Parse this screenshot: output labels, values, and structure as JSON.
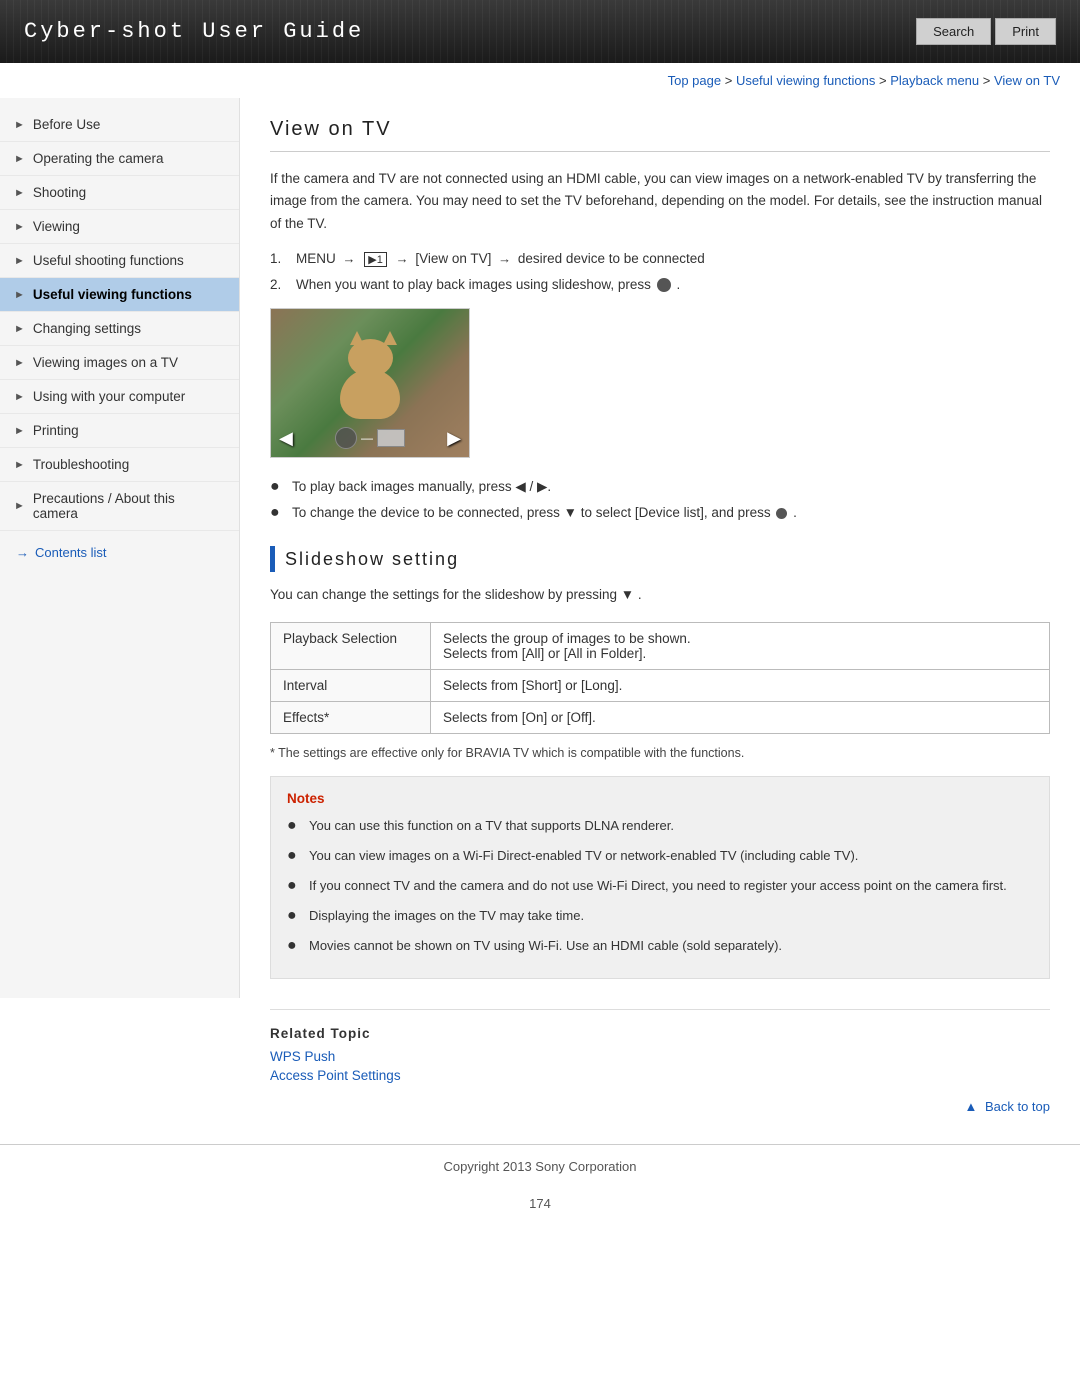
{
  "header": {
    "title": "Cyber-shot User Guide",
    "search_label": "Search",
    "print_label": "Print"
  },
  "breadcrumb": {
    "items": [
      {
        "label": "Top page",
        "href": "#"
      },
      {
        "label": "Useful viewing functions",
        "href": "#"
      },
      {
        "label": "Playback menu",
        "href": "#"
      },
      {
        "label": "View on TV",
        "href": "#"
      }
    ]
  },
  "sidebar": {
    "items": [
      {
        "label": "Before Use",
        "active": false
      },
      {
        "label": "Operating the camera",
        "active": false
      },
      {
        "label": "Shooting",
        "active": false
      },
      {
        "label": "Viewing",
        "active": false
      },
      {
        "label": "Useful shooting functions",
        "active": false
      },
      {
        "label": "Useful viewing functions",
        "active": true
      },
      {
        "label": "Changing settings",
        "active": false
      },
      {
        "label": "Viewing images on a TV",
        "active": false
      },
      {
        "label": "Using with your computer",
        "active": false
      },
      {
        "label": "Printing",
        "active": false
      },
      {
        "label": "Troubleshooting",
        "active": false
      },
      {
        "label": "Precautions / About this camera",
        "active": false
      }
    ],
    "contents_link": "Contents list"
  },
  "content": {
    "page_title": "View on TV",
    "intro": "If the camera and TV are not connected using an HDMI cable, you can view images on a network-enabled TV by transferring the image from the camera. You may need to set the TV beforehand, depending on the model. For details, see the instruction manual of the TV.",
    "steps": [
      {
        "num": "1.",
        "text": "MENU → [▶1] → [View on TV] → desired device to be connected"
      },
      {
        "num": "2.",
        "text": "When you want to play back images using slideshow, press ●."
      }
    ],
    "manual_bullets": [
      "To play back images manually, press ◀ / ▶.",
      "To change the device to be connected, press ▼ to select [Device list], and press ●."
    ],
    "slideshow_section": {
      "heading": "Slideshow setting",
      "description": "You can change the settings for the slideshow by pressing ▼ ."
    },
    "table": {
      "rows": [
        {
          "setting": "Playback Selection",
          "description": "Selects the group of images to be shown. Selects from [All] or [All in Folder]."
        },
        {
          "setting": "Interval",
          "description": "Selects from [Short] or [Long]."
        },
        {
          "setting": "Effects*",
          "description": "Selects from [On] or [Off]."
        }
      ]
    },
    "table_note": "* The settings are effective only for BRAVIA TV which is compatible with the functions.",
    "notes": {
      "title": "Notes",
      "items": [
        "You can use this function on a TV that supports DLNA renderer.",
        "You can view images on a Wi-Fi Direct-enabled TV or network-enabled TV (including cable TV).",
        "If you connect TV and the camera and do not use Wi-Fi Direct, you need to register your access point on the camera first.",
        "Displaying the images on the TV may take time.",
        "Movies cannot be shown on TV using Wi-Fi. Use an HDMI cable (sold separately)."
      ]
    },
    "related_topic": {
      "label": "Related Topic",
      "links": [
        {
          "label": "WPS Push",
          "href": "#"
        },
        {
          "label": "Access Point Settings",
          "href": "#"
        }
      ]
    },
    "back_to_top": "▲ Back to top"
  },
  "footer": {
    "copyright": "Copyright 2013 Sony Corporation",
    "page_number": "174"
  }
}
